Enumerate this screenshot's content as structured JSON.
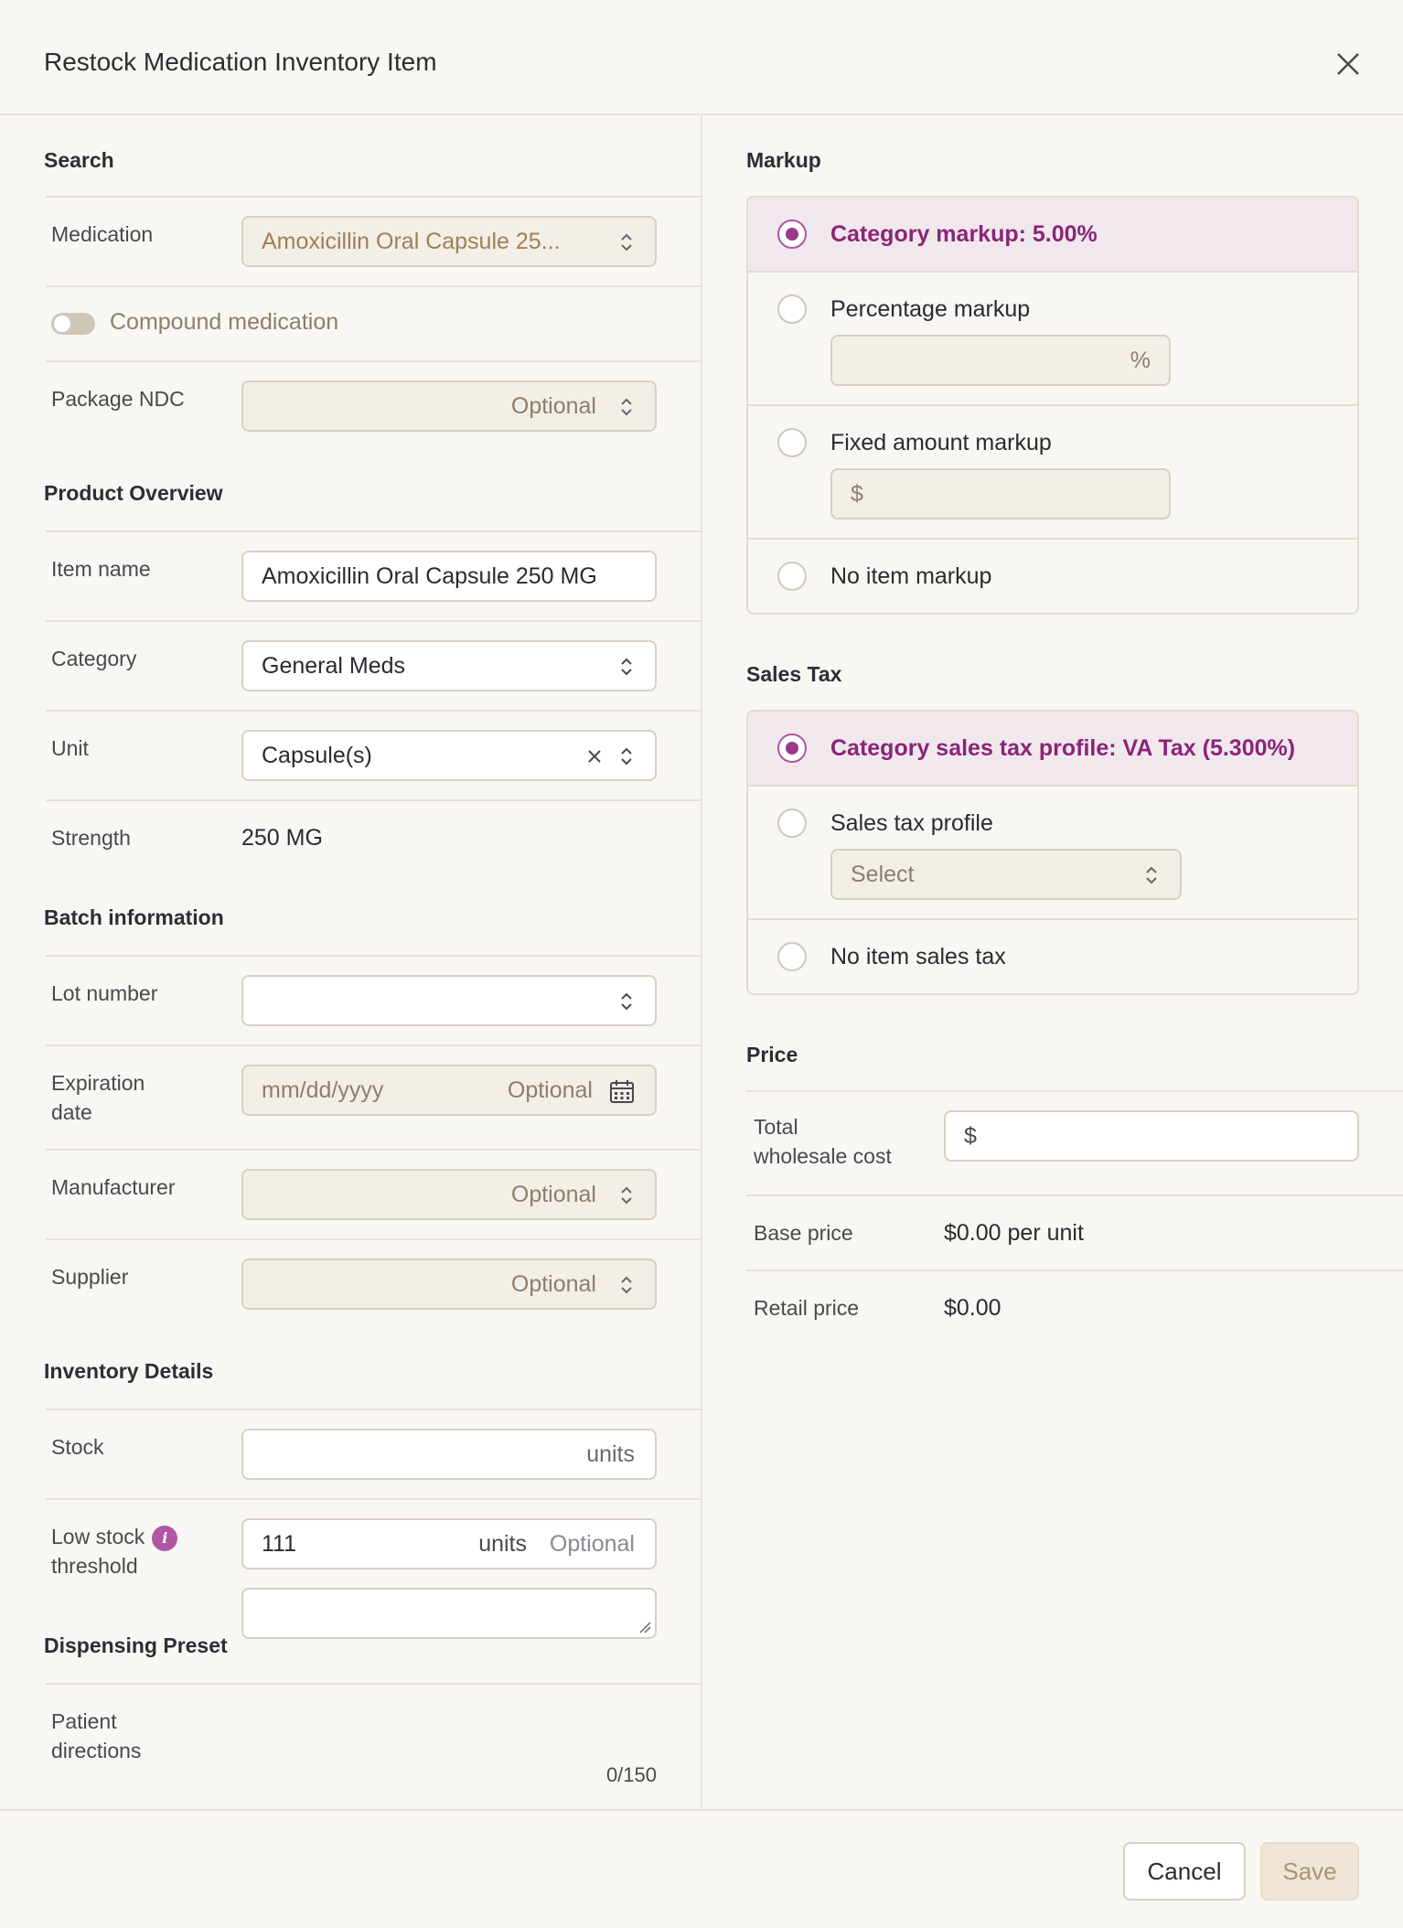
{
  "dialog": {
    "title": "Restock Medication Inventory Item"
  },
  "search": {
    "section_title": "Search",
    "medication_label": "Medication",
    "medication_value": "Amoxicillin Oral Capsule 25...",
    "compound_label": "Compound medication",
    "compound_on": false,
    "ndc_label": "Package NDC",
    "ndc_placeholder": "Optional"
  },
  "product": {
    "section_title": "Product Overview",
    "item_name_label": "Item name",
    "item_name_value": "Amoxicillin Oral Capsule 250 MG",
    "category_label": "Category",
    "category_value": "General Meds",
    "unit_label": "Unit",
    "unit_value": "Capsule(s)",
    "strength_label": "Strength",
    "strength_value": "250 MG"
  },
  "batch": {
    "section_title": "Batch information",
    "lot_label": "Lot number",
    "lot_value": "",
    "expiration_label_1": "Expiration",
    "expiration_label_2": "date",
    "expiration_placeholder": "mm/dd/yyyy",
    "expiration_optional": "Optional",
    "manufacturer_label": "Manufacturer",
    "manufacturer_placeholder": "Optional",
    "supplier_label": "Supplier",
    "supplier_placeholder": "Optional"
  },
  "inventory": {
    "section_title": "Inventory Details",
    "stock_label": "Stock",
    "stock_unit": "units",
    "low_stock_label_1": "Low stock",
    "low_stock_label_2": "threshold",
    "low_stock_value": "111",
    "low_stock_unit": "units",
    "low_stock_optional": "Optional"
  },
  "dispensing": {
    "section_title": "Dispensing Preset",
    "directions_label_1": "Patient",
    "directions_label_2": "directions",
    "counter": "0/150"
  },
  "markup": {
    "section_title": "Markup",
    "options": [
      {
        "label": "Category markup: 5.00%",
        "selected": true
      },
      {
        "label": "Percentage markup",
        "selected": false,
        "input_suffix": "%"
      },
      {
        "label": "Fixed amount markup",
        "selected": false,
        "input_prefix": "$"
      },
      {
        "label": "No item markup",
        "selected": false
      }
    ]
  },
  "sales_tax": {
    "section_title": "Sales Tax",
    "options": [
      {
        "label": "Category sales tax profile: VA Tax (5.300%)",
        "selected": true
      },
      {
        "label": "Sales tax profile",
        "selected": false,
        "select_placeholder": "Select"
      },
      {
        "label": "No item sales tax",
        "selected": false
      }
    ]
  },
  "price": {
    "section_title": "Price",
    "wholesale_label_1": "Total",
    "wholesale_label_2": "wholesale cost",
    "wholesale_prefix": "$",
    "base_label": "Base price",
    "base_value": "$0.00 per unit",
    "retail_label": "Retail price",
    "retail_value": "$0.00"
  },
  "footer": {
    "cancel_label": "Cancel",
    "save_label": "Save"
  },
  "colors": {
    "accent": "#9a3a8c",
    "selected_bg": "#f1e8ee",
    "border": "#d9d0c2",
    "background": "#f8f7f4"
  }
}
